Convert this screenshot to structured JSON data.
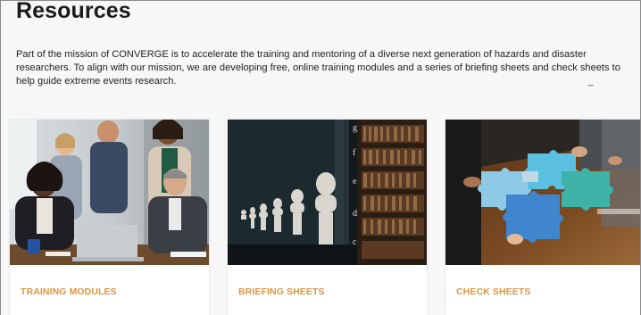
{
  "page": {
    "title": "Resources",
    "intro_lines": [
      "Part of the mission of CONVERGE is to accelerate the training and mentoring of a diverse next generation of hazards and disaster",
      "researchers. To align with our mission, we are developing free, online training modules and a series of briefing sheets and check sheets to",
      "help guide extreme events research."
    ],
    "dash": "_"
  },
  "cards": [
    {
      "title": "TRAINING MODULES",
      "image": "team-meeting-photo"
    },
    {
      "title": "BRIEFING SHEETS",
      "image": "library-busts-photo"
    },
    {
      "title": "CHECK SHEETS",
      "image": "puzzle-pieces-photo"
    }
  ],
  "colors": {
    "accent": "#e0963c",
    "puzzle_blue": "#3f86cf",
    "puzzle_teal": "#3fb3a8",
    "table_wood": "#7a4a22"
  }
}
